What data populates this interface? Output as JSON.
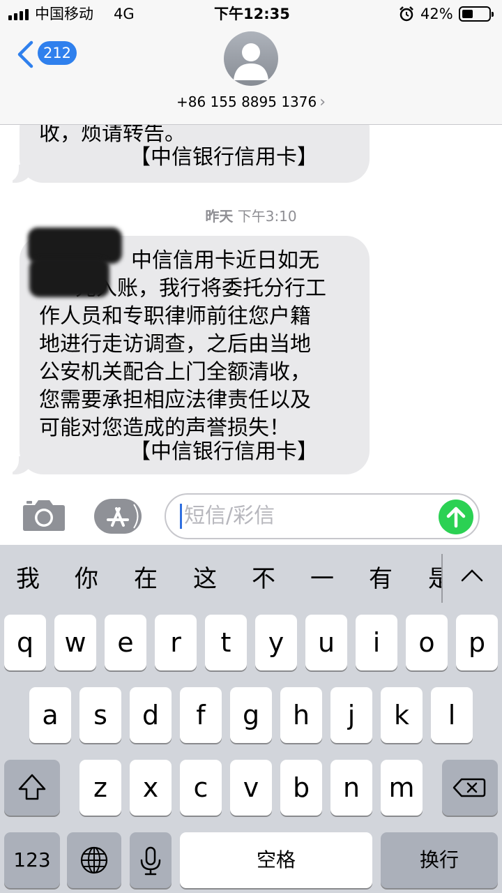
{
  "status_bar": {
    "carrier": "中国移动",
    "network": "4G",
    "time": "下午12:35",
    "battery_percent": "42%",
    "battery_level": 0.42,
    "icons": [
      "signal-icon",
      "alarm-icon",
      "battery-icon"
    ]
  },
  "header": {
    "unread_count": "212",
    "contact_number": "+86 155 8895 1376",
    "icons": [
      "back-chevron-icon",
      "avatar-icon",
      "chevron-right-icon"
    ]
  },
  "messages": {
    "first": {
      "lines": [
        "收，烦请转告。",
        "【中信银行信用卡】"
      ]
    },
    "timestamp_day": "昨天",
    "timestamp_time": "下午3:10",
    "second": {
      "lines": [
        "中信信用卡近日如无",
        "元入账，我行将委托分行工",
        "作人员和专职律师前往您户籍",
        "地进行走访调查，之后由当地",
        "公安机关配合上门全额清收，",
        "您需要承担相应法律责任以及",
        "可能对您造成的声誉损失！",
        "【中信银行信用卡】"
      ]
    }
  },
  "composer": {
    "placeholder": "短信/彩信",
    "icons": [
      "camera-icon",
      "app-store-icon",
      "send-arrow-icon"
    ]
  },
  "keyboard": {
    "candidates": [
      "我",
      "你",
      "在",
      "这",
      "不",
      "一",
      "有",
      "是"
    ],
    "row1": [
      "q",
      "w",
      "e",
      "r",
      "t",
      "y",
      "u",
      "i",
      "o",
      "p"
    ],
    "row2": [
      "a",
      "s",
      "d",
      "f",
      "g",
      "h",
      "j",
      "k",
      "l"
    ],
    "row3": [
      "z",
      "x",
      "c",
      "v",
      "b",
      "n",
      "m"
    ],
    "numbers_label": "123",
    "space_label": "空格",
    "return_label": "换行",
    "icons": [
      "shift-icon",
      "delete-icon",
      "globe-icon",
      "microphone-icon",
      "expand-chevron-icon"
    ]
  },
  "colors": {
    "accent": "#2f80ed",
    "send": "#2bd153",
    "bubble": "#e9e9eb",
    "keyboard_bg": "#d2d5db"
  }
}
